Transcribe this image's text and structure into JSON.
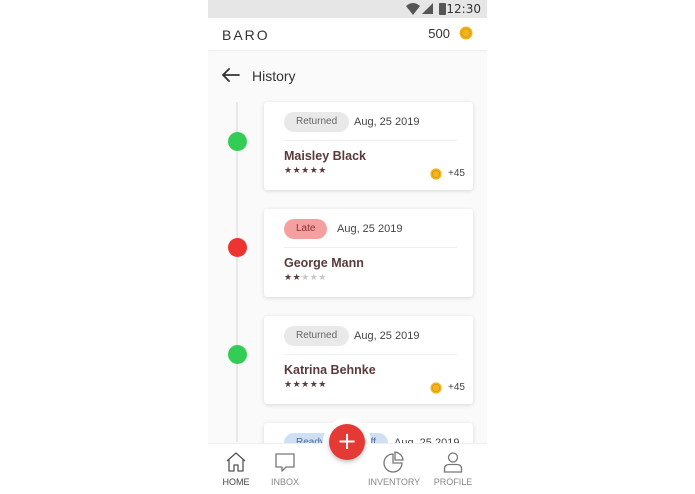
{
  "status_bar": {
    "time": "12:30",
    "icons": [
      "wifi-icon",
      "signal-icon",
      "battery-icon"
    ]
  },
  "app_bar": {
    "brand": "BARO",
    "coin_balance": "500",
    "coin_icon": "coin-icon"
  },
  "header": {
    "title": "History",
    "back_icon": "arrow-left-icon"
  },
  "colors": {
    "accent_red": "#e53935",
    "status_green": "#33cc55",
    "status_red": "#ee3333",
    "text_name": "#5a3a3a"
  },
  "history": [
    {
      "status": "Returned",
      "status_kind": "returned",
      "date": "Aug, 25 2019",
      "name": "Maisley Black",
      "rating": 5,
      "stars": "★★★★★",
      "stars_off": "",
      "reward": "+45",
      "dot_color": "green"
    },
    {
      "status": "Late",
      "status_kind": "late",
      "date": "Aug, 25 2019",
      "name": "George Mann",
      "rating": 2,
      "stars": "★★",
      "stars_off": "★★★",
      "reward": "",
      "dot_color": "red"
    },
    {
      "status": "Returned",
      "status_kind": "returned",
      "date": "Aug, 25 2019",
      "name": "Katrina Behnke",
      "rating": 5,
      "stars": "★★★★★",
      "stars_off": "",
      "reward": "+45",
      "dot_color": "green"
    },
    {
      "status": "Ready for drop off",
      "status_kind": "ready",
      "date": "Aug, 25 2019",
      "name": "",
      "rating": 0,
      "stars": "",
      "stars_off": "",
      "reward": "",
      "dot_color": ""
    }
  ],
  "fab": {
    "label": "+",
    "icon": "plus-icon"
  },
  "bottom_nav": [
    {
      "label": "HOME",
      "icon": "home-icon",
      "active": true
    },
    {
      "label": "INBOX",
      "icon": "chat-icon",
      "active": false
    },
    {
      "label": "INVENTORY",
      "icon": "pie-icon",
      "active": false
    },
    {
      "label": "PROFILE",
      "icon": "user-icon",
      "active": false
    }
  ]
}
